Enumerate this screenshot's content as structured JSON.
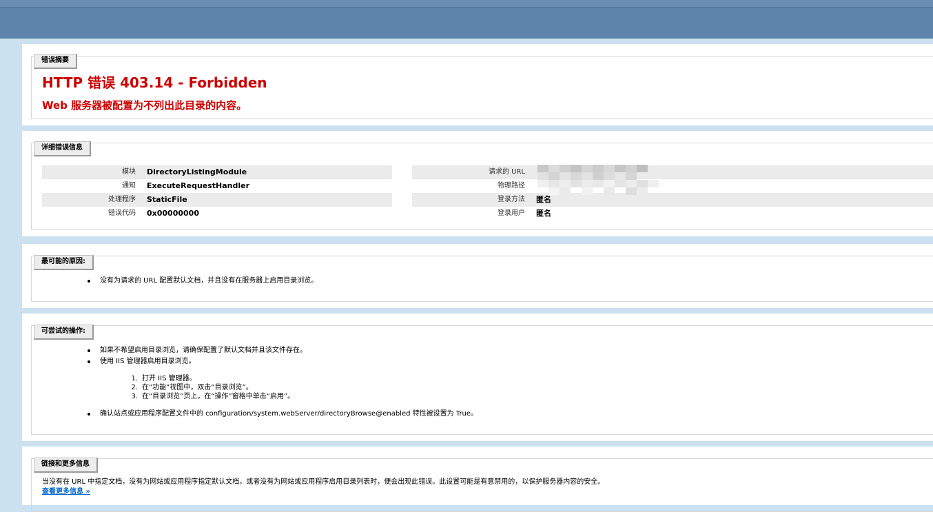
{
  "summary": {
    "legend": "错误摘要",
    "title": "HTTP 错误 403.14 - Forbidden",
    "subtitle": "Web 服务器被配置为不列出此目录的内容。"
  },
  "details": {
    "legend": "详细错误信息",
    "left": [
      {
        "key": "模块",
        "value": "DirectoryListingModule"
      },
      {
        "key": "通知",
        "value": "ExecuteRequestHandler"
      },
      {
        "key": "处理程序",
        "value": "StaticFile"
      },
      {
        "key": "错误代码",
        "value": "0x00000000"
      }
    ],
    "right": [
      {
        "key": "请求的 URL",
        "value": ""
      },
      {
        "key": "物理路径",
        "value": ""
      },
      {
        "key": "登录方法",
        "value": "匿名"
      },
      {
        "key": "登录用户",
        "value": "匿名"
      }
    ]
  },
  "causes": {
    "legend": "最可能的原因:",
    "items": [
      "没有为请求的 URL 配置默认文档，并且没有在服务器上启用目录浏览。"
    ]
  },
  "actions": {
    "legend": "可尝试的操作:",
    "items": [
      "如果不希望启用目录浏览，请确保配置了默认文档并且该文件存在。",
      "使用 IIS 管理器启用目录浏览。",
      "确认站点或应用程序配置文件中的 configuration/system.webServer/directoryBrowse@enabled 特性被设置为 True。"
    ],
    "steps": [
      {
        "num": "1.",
        "text": "打开 IIS 管理器。"
      },
      {
        "num": "2.",
        "text": "在“功能”视图中，双击“目录浏览”。"
      },
      {
        "num": "3.",
        "text": "在“目录浏览”页上，在“操作”窗格中单击“启用”。"
      }
    ]
  },
  "links": {
    "legend": "链接和更多信息",
    "text": "当没有在 URL 中指定文档，没有为网站或应用程序指定默认文档，或者没有为网站或应用程序启用目录列表时，便会出现此错误。此设置可能是有意禁用的，以保护服务器内容的安全。",
    "more": "查看更多信息 »"
  }
}
